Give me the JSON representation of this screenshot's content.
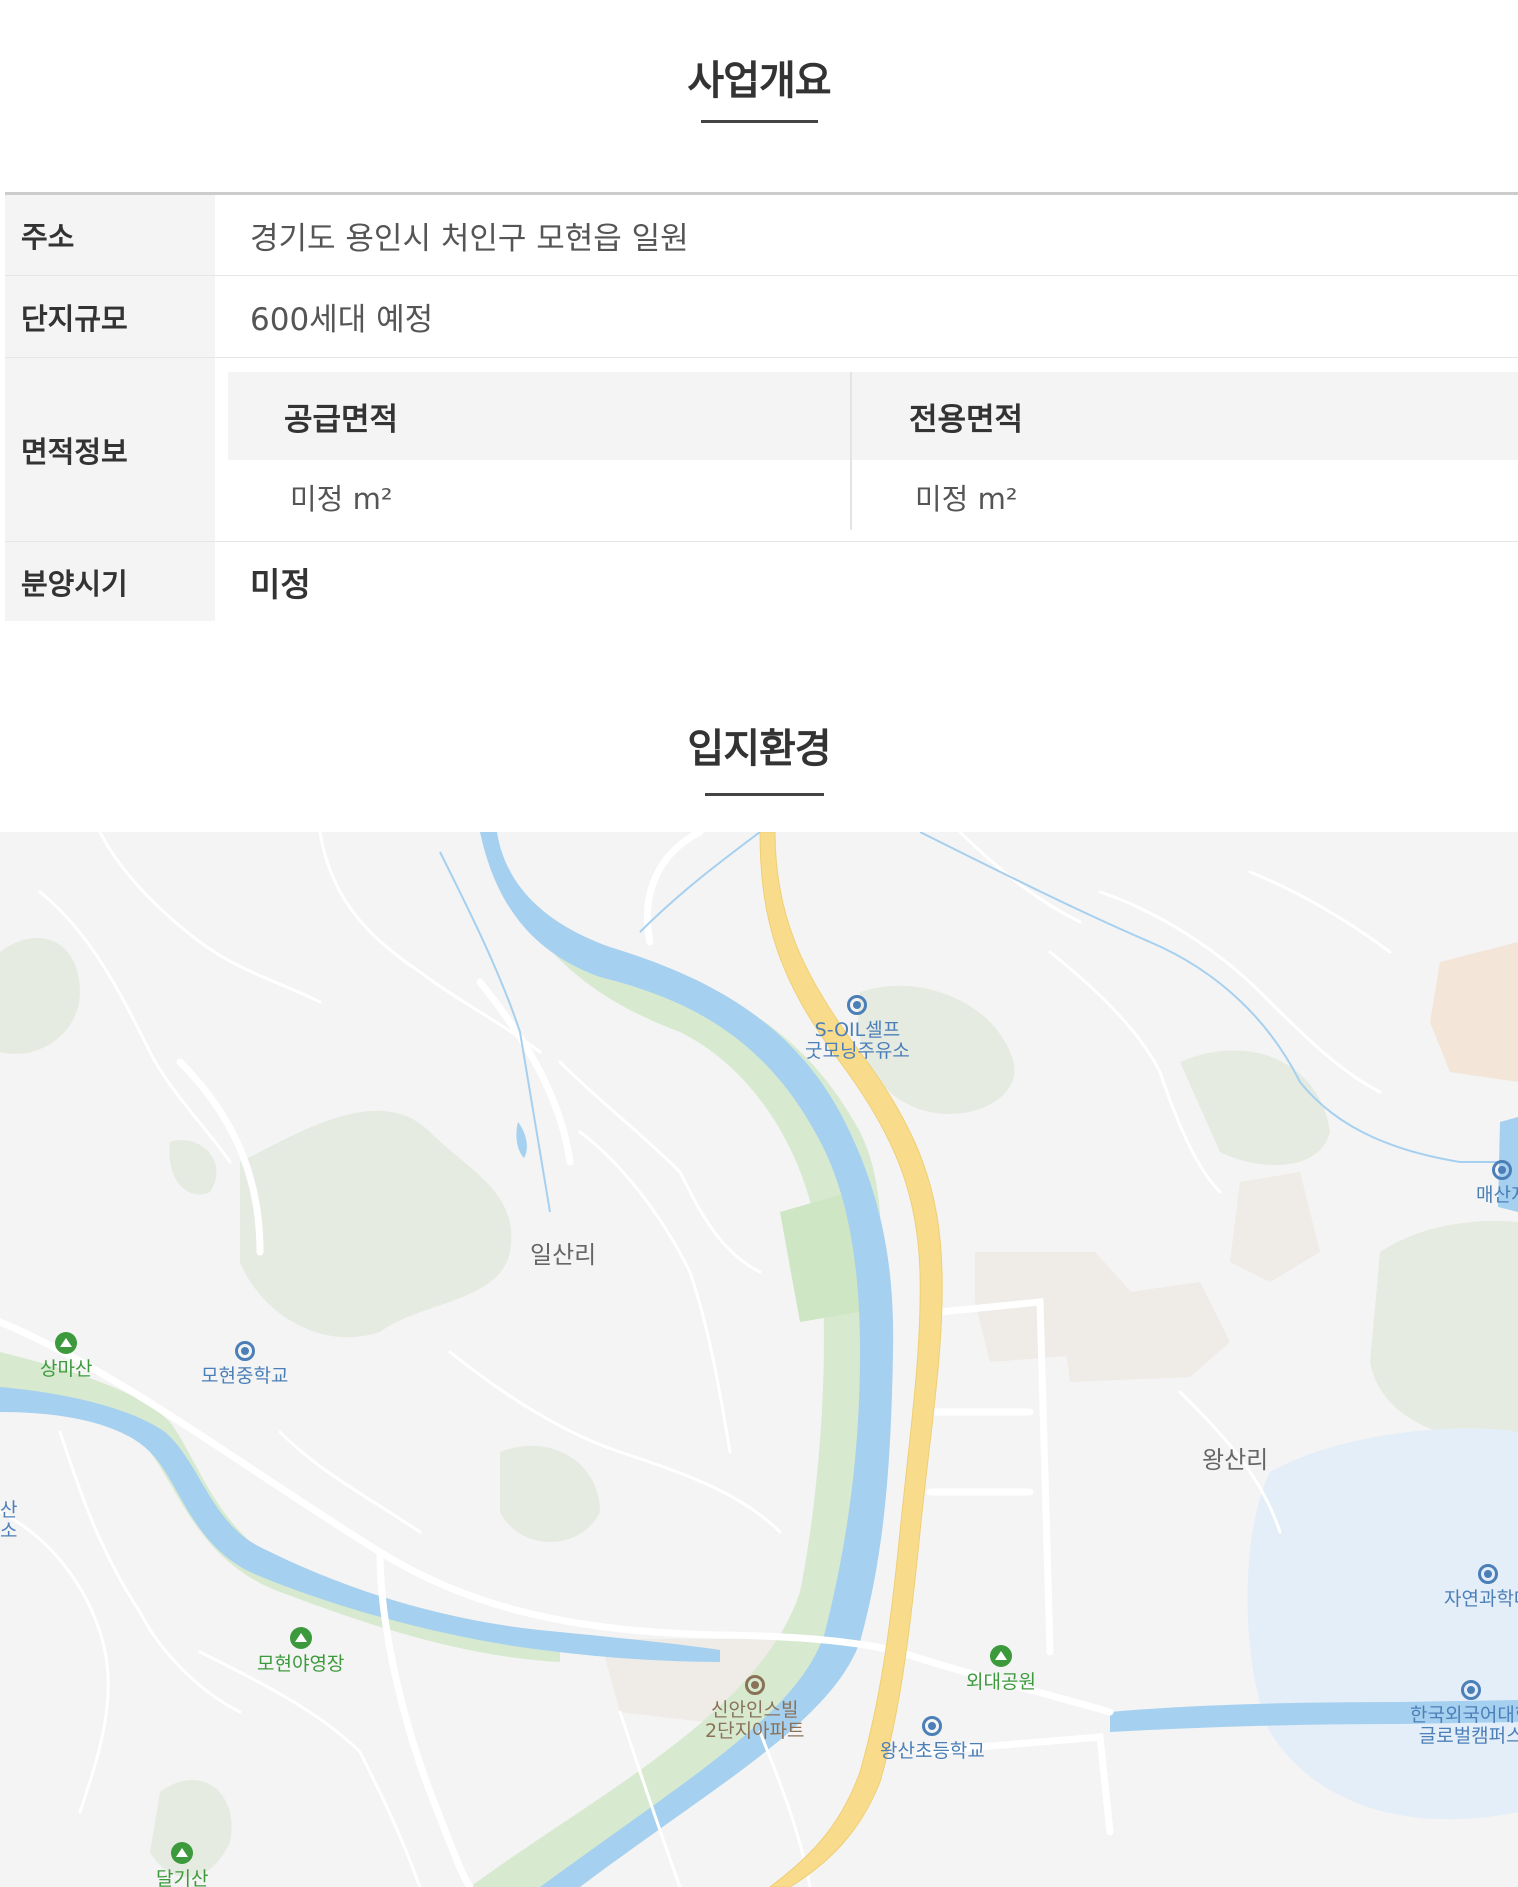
{
  "overview": {
    "title": "사업개요",
    "rows": {
      "address": {
        "label": "주소",
        "value": "경기도 용인시 처인구 모현읍 일원"
      },
      "scale": {
        "label": "단지규모",
        "value": "600세대 예정"
      },
      "area": {
        "label": "면적정보",
        "supply_label": "공급면적",
        "exclusive_label": "전용면적",
        "supply_value": "미정 m²",
        "exclusive_value": "미정 m²"
      },
      "sale": {
        "label": "분양시기",
        "value": "미정"
      }
    }
  },
  "location": {
    "title": "입지환경",
    "map": {
      "labels": {
        "ilsanri": "일산리",
        "wangsanri": "왕산리",
        "gas_station_1": "S-OIL셀프",
        "gas_station_2": "굿모닝주유소",
        "maesan": "매산지",
        "sangmasan": "상마산",
        "mohyeon_middle": "모현중학교",
        "san_cut_1": "산",
        "san_cut_2": "소",
        "campground": "모현야영장",
        "apartment_1": "신안인스빌",
        "apartment_2": "2단지아파트",
        "oedae_park": "외대공원",
        "wangsan_elem": "왕산초등학교",
        "science_1": "자연과학대",
        "hufs_1": "한국외국어대학",
        "hufs_2": "글로벌캠퍼스",
        "dalgisan": "달기산"
      },
      "colors": {
        "river": "#a6d0ef",
        "highway": "#f8dc8c",
        "greenbelt": "#d7ead0",
        "forest": "#e6ebe2",
        "road": "#ffffff",
        "campus": "#e3eef8"
      }
    }
  }
}
